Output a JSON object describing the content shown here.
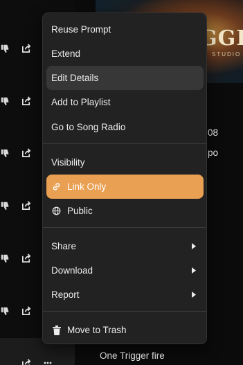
{
  "menu": {
    "items": [
      {
        "label": "Reuse Prompt"
      },
      {
        "label": "Extend"
      },
      {
        "label": "Edit Details"
      },
      {
        "label": "Add to Playlist"
      },
      {
        "label": "Go to Song Radio"
      },
      {
        "label": "Visibility"
      },
      {
        "label": "Link Only",
        "icon": "link-icon"
      },
      {
        "label": "Public",
        "icon": "globe-icon"
      },
      {
        "label": "Share",
        "submenu": true
      },
      {
        "label": "Download",
        "submenu": true
      },
      {
        "label": "Report",
        "submenu": true
      },
      {
        "label": "Move to Trash",
        "icon": "trash-icon"
      }
    ],
    "highlighted": "Edit Details",
    "selected_visibility": "Link Only"
  },
  "background": {
    "cover": {
      "title": "GGE",
      "subtitle": "STUDIO"
    },
    "peek_texts": [
      "08",
      "po",
      "",
      "One Trigger fire"
    ]
  },
  "colors": {
    "menu_bg": "#222222",
    "hover_bg": "#373737",
    "accent": "#eaa052",
    "page_bg": "#0b0b0b"
  }
}
